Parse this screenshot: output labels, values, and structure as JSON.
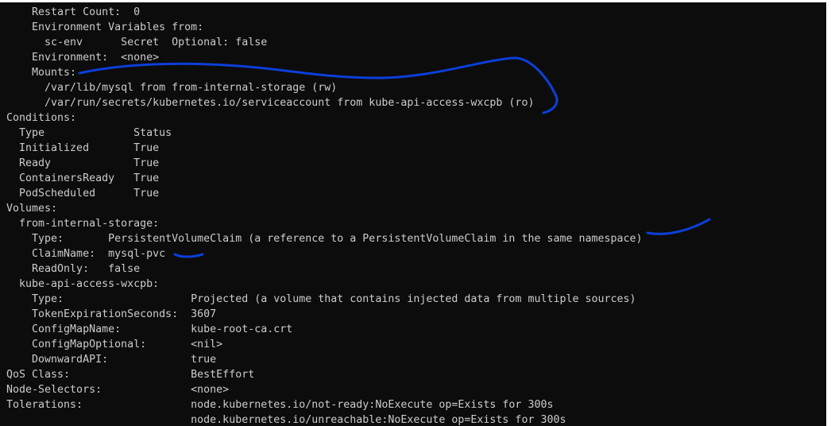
{
  "terminal": {
    "lines": [
      "    Restart Count:  0",
      "    Environment Variables from:",
      "      sc-env      Secret  Optional: false",
      "    Environment:  <none>",
      "    Mounts:",
      "      /var/lib/mysql from from-internal-storage (rw)",
      "      /var/run/secrets/kubernetes.io/serviceaccount from kube-api-access-wxcpb (ro)",
      "Conditions:",
      "  Type              Status",
      "  Initialized       True",
      "  Ready             True",
      "  ContainersReady   True",
      "  PodScheduled      True",
      "Volumes:",
      "  from-internal-storage:",
      "    Type:       PersistentVolumeClaim (a reference to a PersistentVolumeClaim in the same namespace)",
      "    ClaimName:  mysql-pvc",
      "    ReadOnly:   false",
      "  kube-api-access-wxcpb:",
      "    Type:                    Projected (a volume that contains injected data from multiple sources)",
      "    TokenExpirationSeconds:  3607",
      "    ConfigMapName:           kube-root-ca.crt",
      "    ConfigMapOptional:       <nil>",
      "    DownwardAPI:             true",
      "QoS Class:                   BestEffort",
      "Node-Selectors:              <none>",
      "Tolerations:                 node.kubernetes.io/not-ready:NoExecute op=Exists for 300s",
      "                             node.kubernetes.io/unreachable:NoExecute op=Exists for 300s"
    ]
  },
  "colors": {
    "background": "#0c0c0c",
    "text": "#cccccc",
    "annotation": "#0b3fd9"
  }
}
